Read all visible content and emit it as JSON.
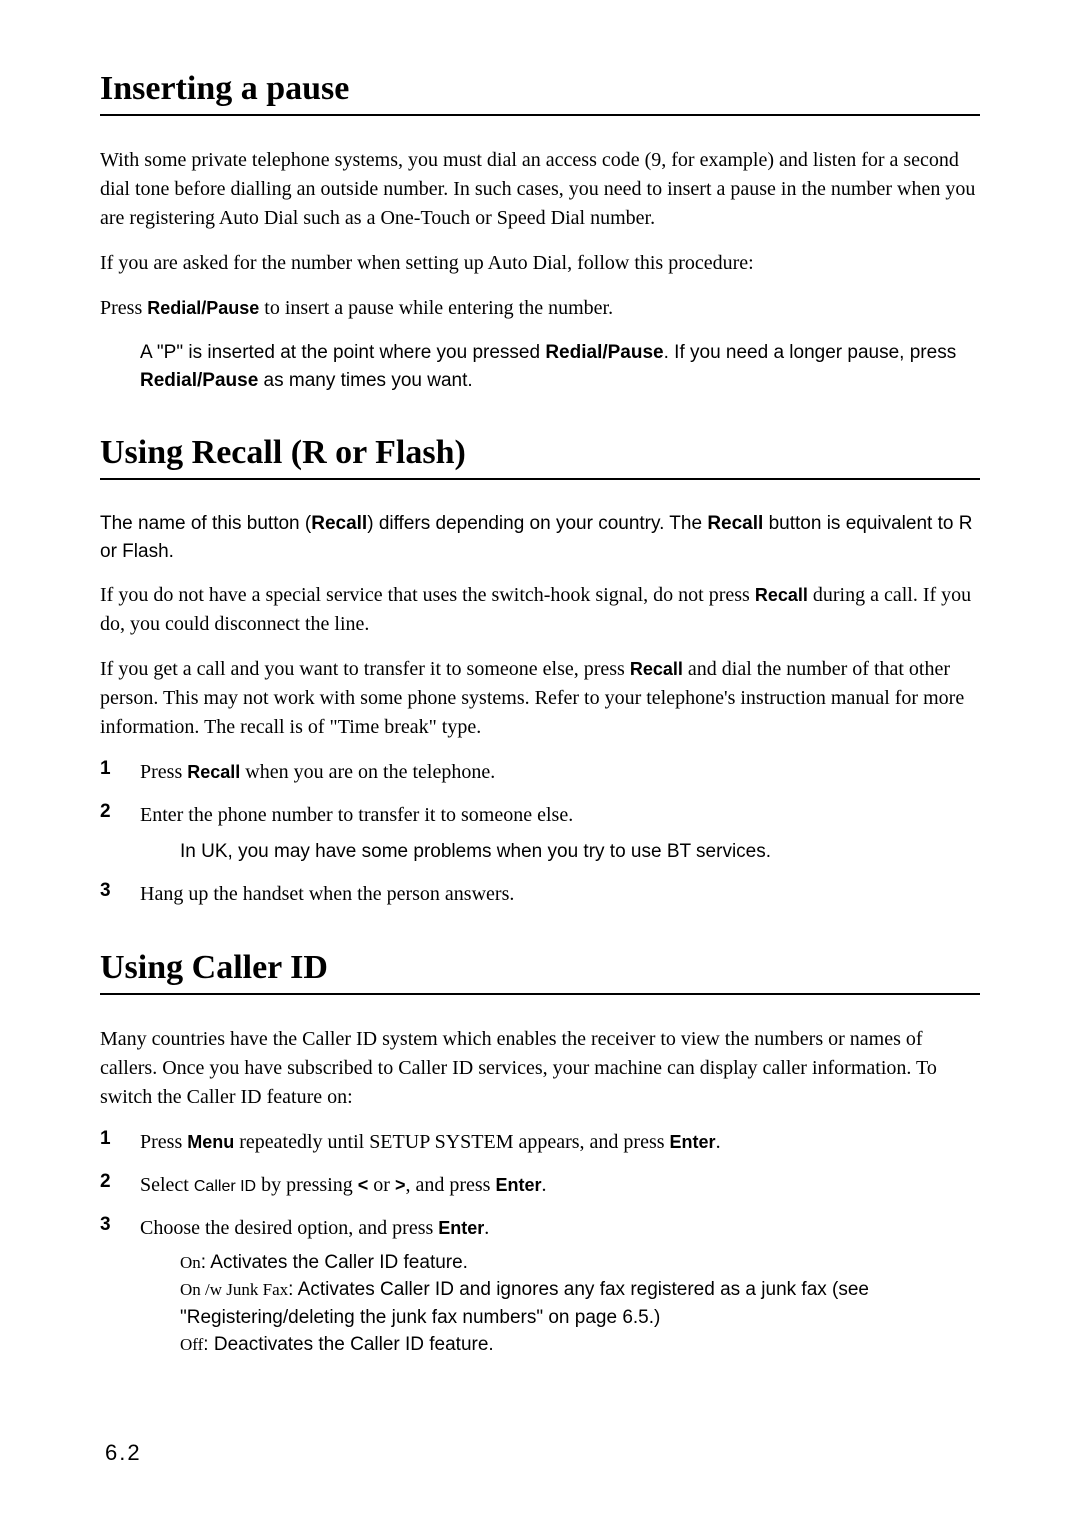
{
  "pageNumber": "6.2",
  "section1": {
    "title": "Inserting a pause",
    "p1": "With some private telephone systems, you must dial an access code (9, for example) and listen for a second dial tone before dialling an outside number. In such cases, you need to insert a pause in the number when you are registering Auto Dial such as a One-Touch or Speed Dial number.",
    "p2": "If you are asked for the number when setting up Auto Dial, follow this procedure:",
    "p3_a": "Press ",
    "p3_key": "Redial/Pause",
    "p3_b": " to insert a pause while entering the number.",
    "note_a": "A \"P\" is inserted at the point where you pressed ",
    "note_key1": "Redial/Pause",
    "note_b": ". If you need a longer pause, press ",
    "note_key2": "Redial/Pause",
    "note_c": " as many times you want."
  },
  "section2": {
    "title": "Using Recall (R or Flash)",
    "p1_a": "The name of this button (",
    "p1_key1": "Recall",
    "p1_b": ") differs depending on your country. The ",
    "p1_key2": "Recall",
    "p1_c": " button is equivalent to R or Flash.",
    "p2_a": "If you do not have a special service that uses the switch-hook signal, do not press ",
    "p2_key": "Recall",
    "p2_b": " during a call. If you do, you could disconnect the line.",
    "p3_a": "If you get a call and you want to transfer it to someone else, press ",
    "p3_key": "Recall",
    "p3_b": " and dial the number of that other person. This may not work with some phone systems. Refer to your telephone's instruction manual for more information. The recall is of \"Time break\" type.",
    "steps": {
      "s1_a": "Press ",
      "s1_key": "Recall",
      "s1_b": " when you are on the telephone.",
      "s2": "Enter the phone number to transfer it to someone else.",
      "s2_note": "In UK, you may have some problems when you try to use BT services.",
      "s3": "Hang up the handset when the person answers."
    }
  },
  "section3": {
    "title": "Using Caller ID",
    "p1": "Many countries have the Caller ID system which enables the receiver to view the numbers or names of callers. Once you have subscribed to Caller ID services, your machine can display caller information. To switch the Caller ID feature on:",
    "steps": {
      "s1_a": "Press ",
      "s1_key1": "Menu",
      "s1_b": " repeatedly until ",
      "s1_sc": "SETUP SYSTEM",
      "s1_c": " appears, and press ",
      "s1_key2": "Enter",
      "s1_d": ".",
      "s2_a": "Select ",
      "s2_lab": "Caller ID",
      "s2_b": " by pressing ",
      "s2_key1": "<",
      "s2_c": " or ",
      "s2_key2": ">",
      "s2_d": ", and press ",
      "s2_key3": "Enter",
      "s2_e": ".",
      "s3_a": "Choose the desired option, and press ",
      "s3_key": "Enter",
      "s3_b": "."
    },
    "options": {
      "o1_lab": "On",
      "o1_txt": ": Activates the Caller ID feature.",
      "o2_lab": "On /w Junk Fax",
      "o2_txt": ": Activates Caller ID and ignores any fax registered as a junk fax (see \"Registering/deleting the junk fax numbers\" on page 6.5.)",
      "o3_lab": "Off",
      "o3_txt": ": Deactivates the Caller ID feature."
    }
  }
}
